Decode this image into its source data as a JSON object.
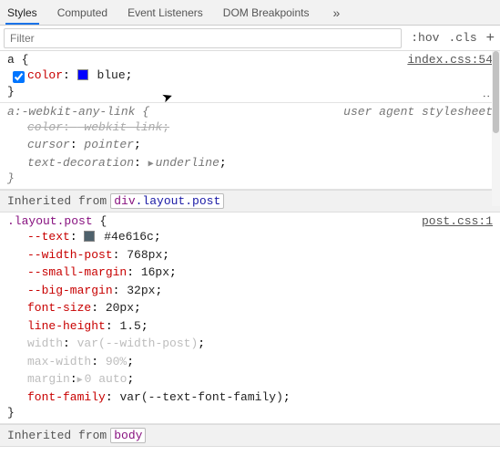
{
  "tabs": {
    "items": [
      "Styles",
      "Computed",
      "Event Listeners",
      "DOM Breakpoints"
    ],
    "active": 0,
    "more": "»"
  },
  "filter": {
    "placeholder": "Filter",
    "hov": ":hov",
    "cls": ".cls",
    "plus": "+"
  },
  "rule1": {
    "selector": "a",
    "open": "{",
    "close": "}",
    "src": "index.css:54",
    "decl_prop": "color",
    "decl_val": "blue",
    "swatch": "#0000ff",
    "kebab": "⋮"
  },
  "rule2": {
    "selector": "a:-webkit-any-link",
    "open": "{",
    "close": "}",
    "ua_label": "user agent stylesheet",
    "d1_prop": "color",
    "d1_val": "-webkit-link",
    "d2_prop": "cursor",
    "d2_val": "pointer",
    "d3_prop": "text-decoration",
    "d3_tri": "▶",
    "d3_val": "underline"
  },
  "inh1": {
    "label": "Inherited from",
    "tag": "div",
    "cls": ".layout.post"
  },
  "rule3": {
    "selector": ".layout.post",
    "open": "{",
    "close": "}",
    "src": "post.css:1",
    "d1_prop": "--text",
    "d1_swatch": "#4e616c",
    "d1_val": "#4e616c",
    "d2_prop": "--width-post",
    "d2_val": "768px",
    "d3_prop": "--small-margin",
    "d3_val": "16px",
    "d4_prop": "--big-margin",
    "d4_val": "32px",
    "d5_prop": "font-size",
    "d5_val": "20px",
    "d6_prop": "line-height",
    "d6_val": "1.5",
    "d7_prop": "width",
    "d7_val": "var(--width-post)",
    "d8_prop": "max-width",
    "d8_val": "90%",
    "d9_prop": "margin",
    "d9_tri": "▶",
    "d9_val": "0 auto",
    "d10_prop": "font-family",
    "d10_val": "var(--text-font-family)"
  },
  "inh2": {
    "label": "Inherited from",
    "tag": "body"
  }
}
